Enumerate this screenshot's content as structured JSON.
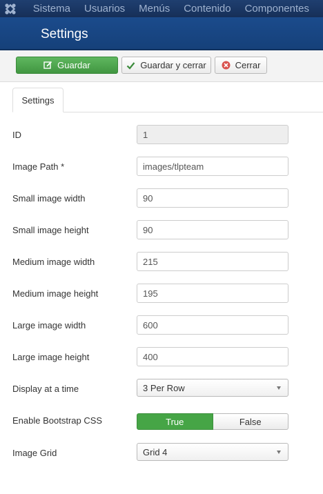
{
  "topnav": {
    "logo_icon": "joomla-logo-icon",
    "items": [
      "Sistema",
      "Usuarios",
      "Menús",
      "Contenido",
      "Componentes"
    ]
  },
  "title": "Settings",
  "toolbar": {
    "save_label": "Guardar",
    "save_icon": "edit-icon",
    "save_close_label": "Guardar y cerrar",
    "save_close_icon": "check-icon",
    "close_label": "Cerrar",
    "close_icon": "cancel-circle-icon"
  },
  "tabs": [
    {
      "label": "Settings"
    }
  ],
  "form": {
    "id": {
      "label": "ID",
      "value": "1"
    },
    "image_path": {
      "label": "Image Path *",
      "value": "images/tlpteam"
    },
    "small_width": {
      "label": "Small image width",
      "value": "90"
    },
    "small_height": {
      "label": "Small image height",
      "value": "90"
    },
    "medium_width": {
      "label": "Medium image width",
      "value": "215"
    },
    "medium_height": {
      "label": "Medium image height",
      "value": "195"
    },
    "large_width": {
      "label": "Large image width",
      "value": "600"
    },
    "large_height": {
      "label": "Large image height",
      "value": "400"
    },
    "display": {
      "label": "Display at a time",
      "value": "3 Per Row"
    },
    "bootstrap": {
      "label": "Enable Bootstrap CSS",
      "true_label": "True",
      "false_label": "False",
      "selected": "True"
    },
    "grid": {
      "label": "Image Grid",
      "value": "Grid 4"
    }
  },
  "colors": {
    "nav": "#1a3867",
    "title_bar": "#184684",
    "success": "#46a546",
    "danger": "#d9534f"
  }
}
